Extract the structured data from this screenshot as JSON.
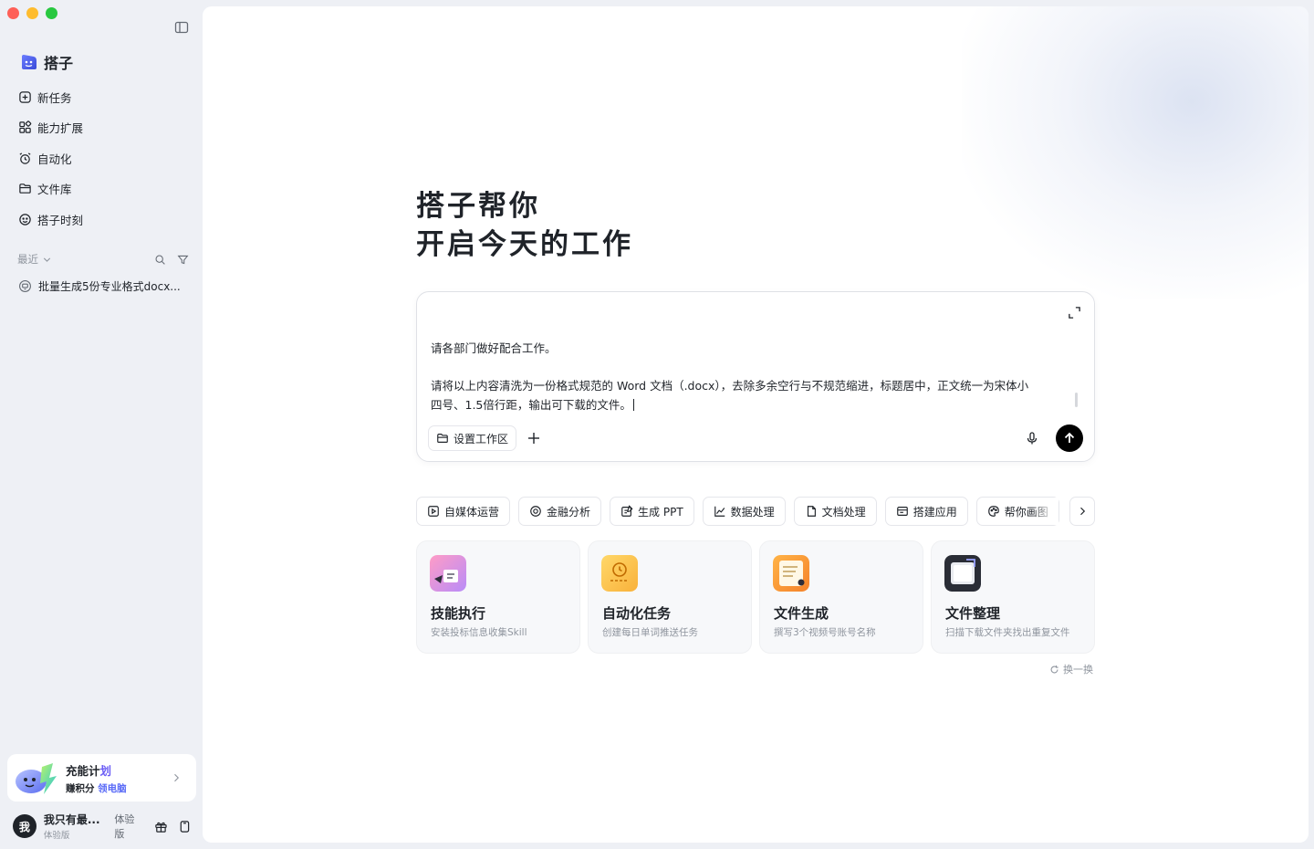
{
  "app": {
    "brand": "搭子"
  },
  "sidebar": {
    "nav": [
      {
        "label": "新任务",
        "icon": "new-task-icon"
      },
      {
        "label": "能力扩展",
        "icon": "extensions-icon"
      },
      {
        "label": "自动化",
        "icon": "alarm-icon"
      },
      {
        "label": "文件库",
        "icon": "folder-icon"
      },
      {
        "label": "搭子时刻",
        "icon": "moments-icon"
      }
    ],
    "recent_label": "最近",
    "recent_items": [
      {
        "label": "批量生成5份专业格式docx..."
      }
    ],
    "promo": {
      "title_main": "充能计",
      "title_accent": "划",
      "sub_main": "赚积分",
      "sub_accent": "领电脑"
    },
    "user": {
      "avatar_text": "我",
      "name": "我只有最...",
      "plan": "体验版",
      "badge": "体验版"
    }
  },
  "main": {
    "hero_line1": "搭子帮你",
    "hero_line2": "开启今天的工作",
    "composer": {
      "line1": "请各部门做好配合工作。",
      "line2": "请将以上内容清洗为一份格式规范的 Word 文档（.docx），去除多余空行与不规范缩进，标题居中，正文统一为宋体小",
      "line3": "四号、1.5倍行距，输出可下载的文件。",
      "workspace_label": "设置工作区"
    },
    "chips": [
      {
        "label": "自媒体运营",
        "icon": "play-square-icon"
      },
      {
        "label": "金融分析",
        "icon": "target-icon"
      },
      {
        "label": "生成 PPT",
        "icon": "edit-doc-icon"
      },
      {
        "label": "数据处理",
        "icon": "line-chart-icon"
      },
      {
        "label": "文档处理",
        "icon": "document-icon"
      },
      {
        "label": "搭建应用",
        "icon": "app-window-icon"
      },
      {
        "label": "帮你画图",
        "icon": "palette-icon"
      }
    ],
    "cards": [
      {
        "title": "技能执行",
        "sub": "安装投标信息收集Skill"
      },
      {
        "title": "自动化任务",
        "sub": "创建每日单词推送任务"
      },
      {
        "title": "文件生成",
        "sub": "撰写3个视频号账号名称"
      },
      {
        "title": "文件整理",
        "sub": "扫描下载文件夹找出重复文件"
      }
    ],
    "refresh_label": "换一换"
  },
  "colors": {
    "accent": "#6a5cf5",
    "send_button": "#000000",
    "sidebar_bg": "#eef0f5"
  }
}
